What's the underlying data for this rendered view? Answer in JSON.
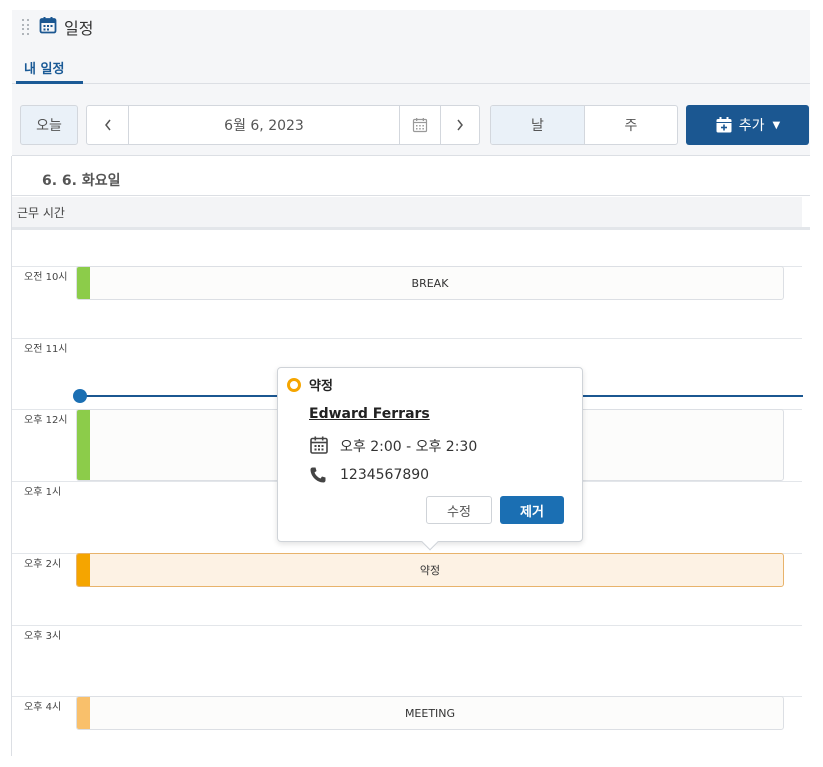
{
  "panel": {
    "title": "일정",
    "tabs": [
      {
        "label": "내 일정",
        "active": true
      }
    ]
  },
  "toolbar": {
    "today_label": "오늘",
    "date_value": "6월 6, 2023",
    "views": [
      {
        "label": "날",
        "active": true
      },
      {
        "label": "주",
        "active": false
      }
    ],
    "add_label": "추가",
    "add_color": "#1b5791"
  },
  "day": {
    "title": "6. 6. 화요일",
    "worktime_label": "근무 시간"
  },
  "hours": [
    "오전 10시",
    "오전 11시",
    "오후 12시",
    "오후 1시",
    "오후 2시",
    "오후 3시",
    "오후 4시"
  ],
  "events": [
    {
      "label": "BREAK",
      "color": "#8ccc4a"
    },
    {
      "label": "",
      "color": "#8ccc4a"
    },
    {
      "label": "약정",
      "color": "#f5a500"
    },
    {
      "label": "MEETING",
      "color": "#f9c06b"
    }
  ],
  "popover": {
    "title": "약정",
    "name": "Edward Ferrars",
    "time": "오후 2:00 - 오후 2:30",
    "phone": "1234567890",
    "edit_label": "수정",
    "remove_label": "제거",
    "status_color": "#f5a500"
  }
}
